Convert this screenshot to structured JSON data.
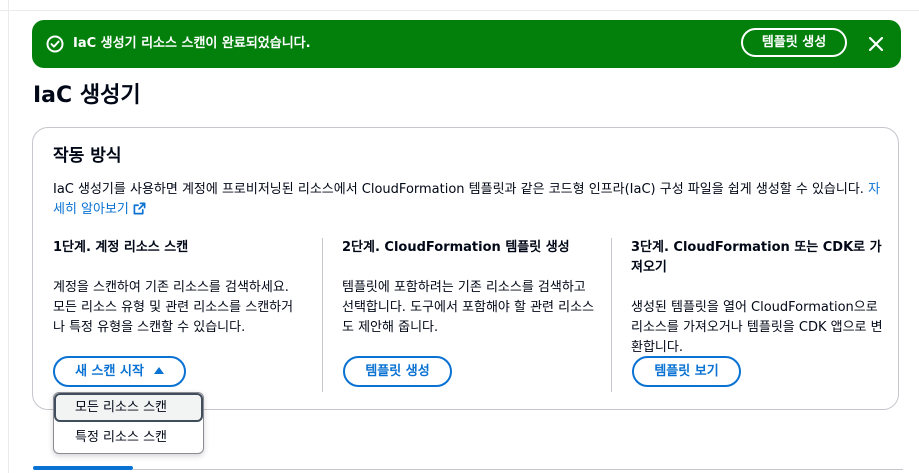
{
  "flash": {
    "message": "IaC 생성기 리소스 스캔이 완료되었습니다.",
    "action_label": "템플릿 생성",
    "background": "#037f0c"
  },
  "page": {
    "title": "IaC 생성기"
  },
  "how_it_works": {
    "title": "작동 방식",
    "description": "IaC 생성기를 사용하면 계정에 프로비저닝된 리소스에서 CloudFormation 템플릿과 같은 코드형 인프라(IaC) 구성 파일을 쉽게 생성할 수 있습니다. ",
    "learn_more": "자세히 알아보기",
    "steps": [
      {
        "title": "1단계. 계정 리소스 스캔",
        "text": "계정을 스캔하여 기존 리소스를 검색하세요. 모든 리소스 유형 및 관련 리소스를 스캔하거나 특정 유형을 스캔할 수 있습니다.",
        "button": "새 스캔 시작"
      },
      {
        "title": "2단계. CloudFormation 템플릿 생성",
        "text": "템플릿에 포함하려는 기존 리소스를 검색하고 선택합니다. 도구에서 포함해야 할 관련 리소스도 제안해 줍니다.",
        "button": "템플릿 생성"
      },
      {
        "title": "3단계. CloudFormation 또는 CDK로 가져오기",
        "text": "생성된 템플릿을 열어 CloudFormation으로 리소스를 가져오거나 템플릿을 CDK 앱으로 변환합니다.",
        "button": "템플릿 보기"
      }
    ]
  },
  "scan_menu": {
    "items": [
      "모든 리소스 스캔",
      "특정 리소스 스캔"
    ]
  },
  "colors": {
    "link": "#0972d3",
    "success": "#037f0c",
    "text": "#000716"
  }
}
